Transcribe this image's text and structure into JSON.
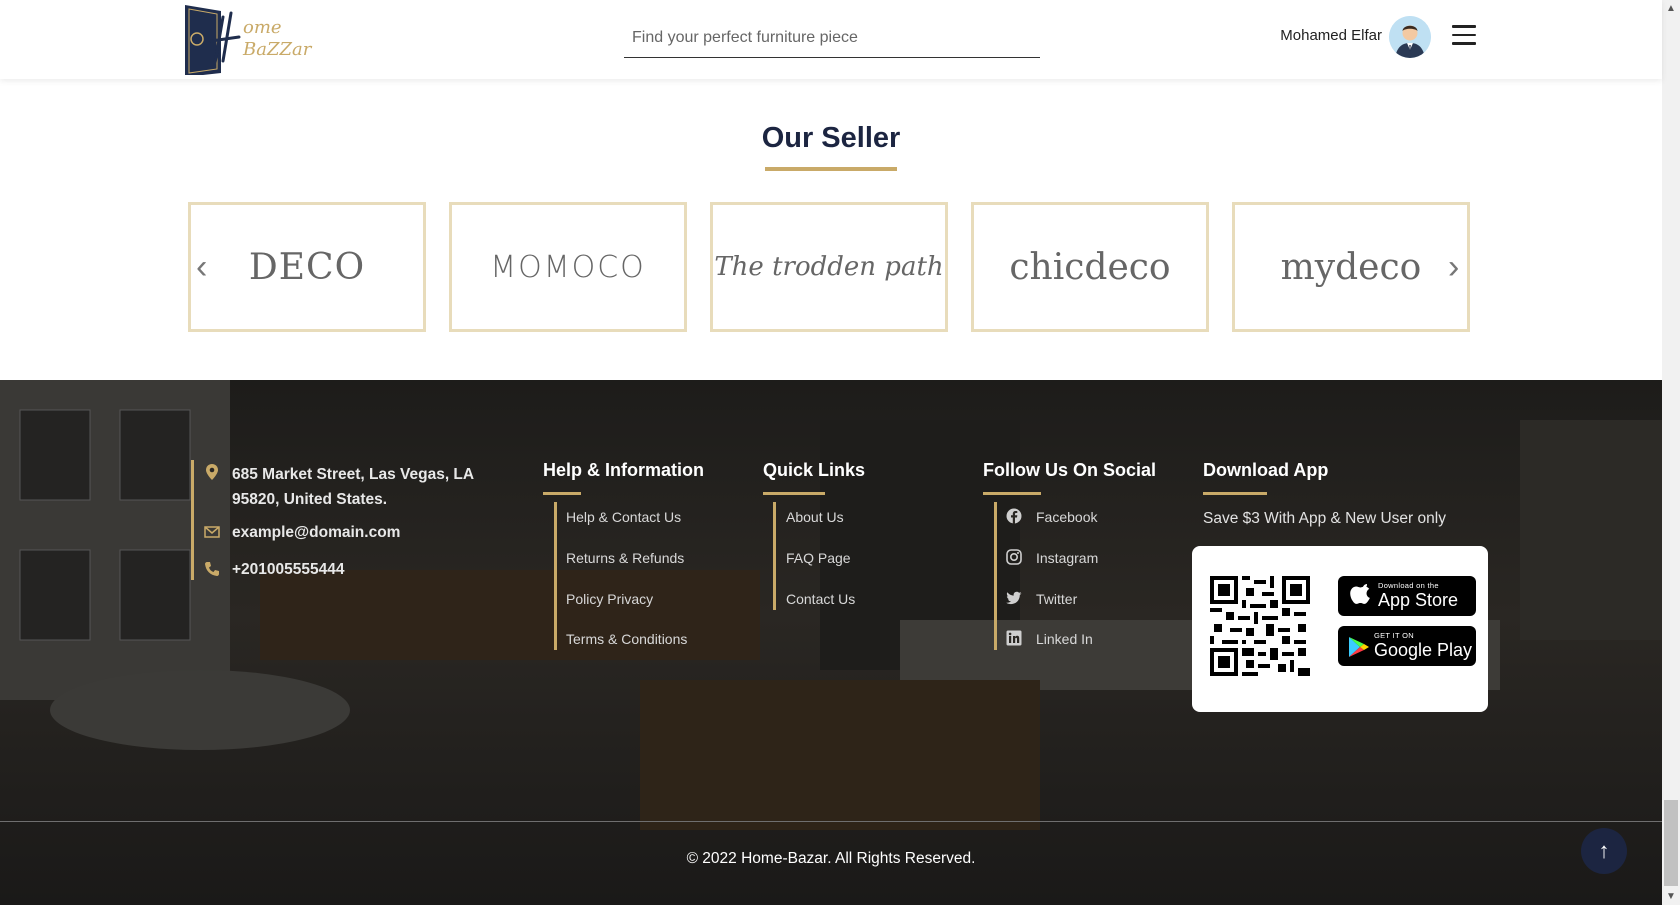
{
  "header": {
    "logo_text_top": "ome",
    "logo_text_bottom": "BaZZar",
    "search_placeholder": "Find your perfect furniture piece",
    "user_name": "Mohamed Elfar"
  },
  "sellers": {
    "title": "Our Seller",
    "brands": [
      "DECO",
      "MOMOCO",
      "The trodden path",
      "chicdeco",
      "mydeco"
    ]
  },
  "footer": {
    "address": "685 Market Street, Las Vegas, LA 95820, United States.",
    "email": "example@domain.com",
    "phone": "+201005555444",
    "help": {
      "title": "Help & Information",
      "links": [
        "Help & Contact Us",
        "Returns & Refunds",
        "Policy Privacy",
        "Terms & Conditions"
      ]
    },
    "quick": {
      "title": "Quick Links",
      "links": [
        "About Us",
        "FAQ Page",
        "Contact Us"
      ]
    },
    "social": {
      "title": "Follow Us On Social",
      "links": [
        "Facebook",
        "Instagram",
        "Twitter",
        "Linked In"
      ]
    },
    "app": {
      "title": "Download App",
      "promo": "Save $3 With App & New User only",
      "appstore_small": "Download on the",
      "appstore_big": "App Store",
      "googleplay_small": "GET IT ON",
      "googleplay_big": "Google Play"
    },
    "copyright": "© 2022 Home-Bazar. All Rights Reserved."
  },
  "colors": {
    "gold": "#c9aa68",
    "navy": "#1c2541"
  }
}
